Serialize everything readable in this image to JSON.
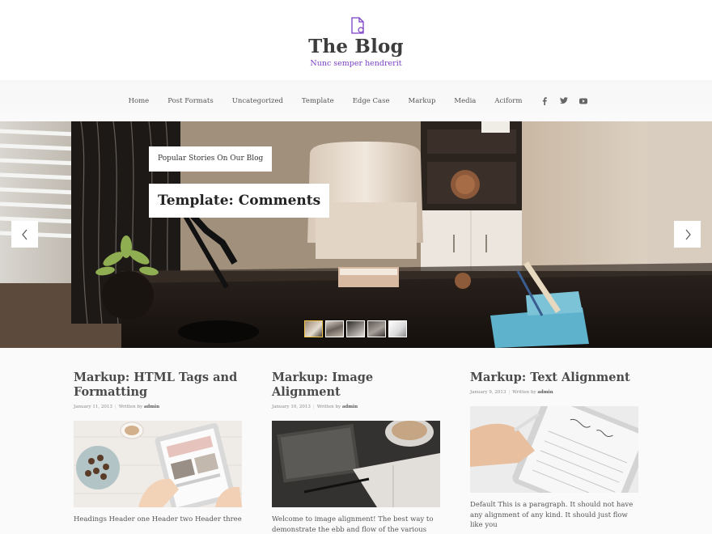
{
  "header": {
    "title": "The Blog",
    "tagline": "Nunc semper hendrerit",
    "logo_icon": "document-icon",
    "accent": "#7a3fc4"
  },
  "nav": {
    "items": [
      "Home",
      "Post Formats",
      "Uncategorized",
      "Template",
      "Edge Case",
      "Markup",
      "Media",
      "Aciform"
    ],
    "social": [
      "facebook-icon",
      "twitter-icon",
      "youtube-icon"
    ]
  },
  "hero": {
    "kicker": "Popular Stories On Our Blog",
    "title": "Template: Comments",
    "prev_icon": "chevron-left-icon",
    "next_icon": "chevron-right-icon",
    "thumbnail_count": 5,
    "active_thumbnail": 1
  },
  "posts": [
    {
      "title": "Markup: HTML Tags and Formatting",
      "date": "January 11, 2013",
      "written_by": "Written by",
      "author": "admin",
      "excerpt": "Headings Header one Header two Header three"
    },
    {
      "title": "Markup: Image Alignment",
      "date": "January 10, 2013",
      "written_by": "Written by",
      "author": "admin",
      "excerpt": "Welcome to image alignment! The best way to demonstrate the ebb and flow of the various image"
    },
    {
      "title": "Markup: Text Alignment",
      "date": "January 9, 2013",
      "written_by": "Written by",
      "author": "admin",
      "excerpt": "Default This is a paragraph. It should not have any alignment of any kind. It should just flow like you"
    }
  ]
}
